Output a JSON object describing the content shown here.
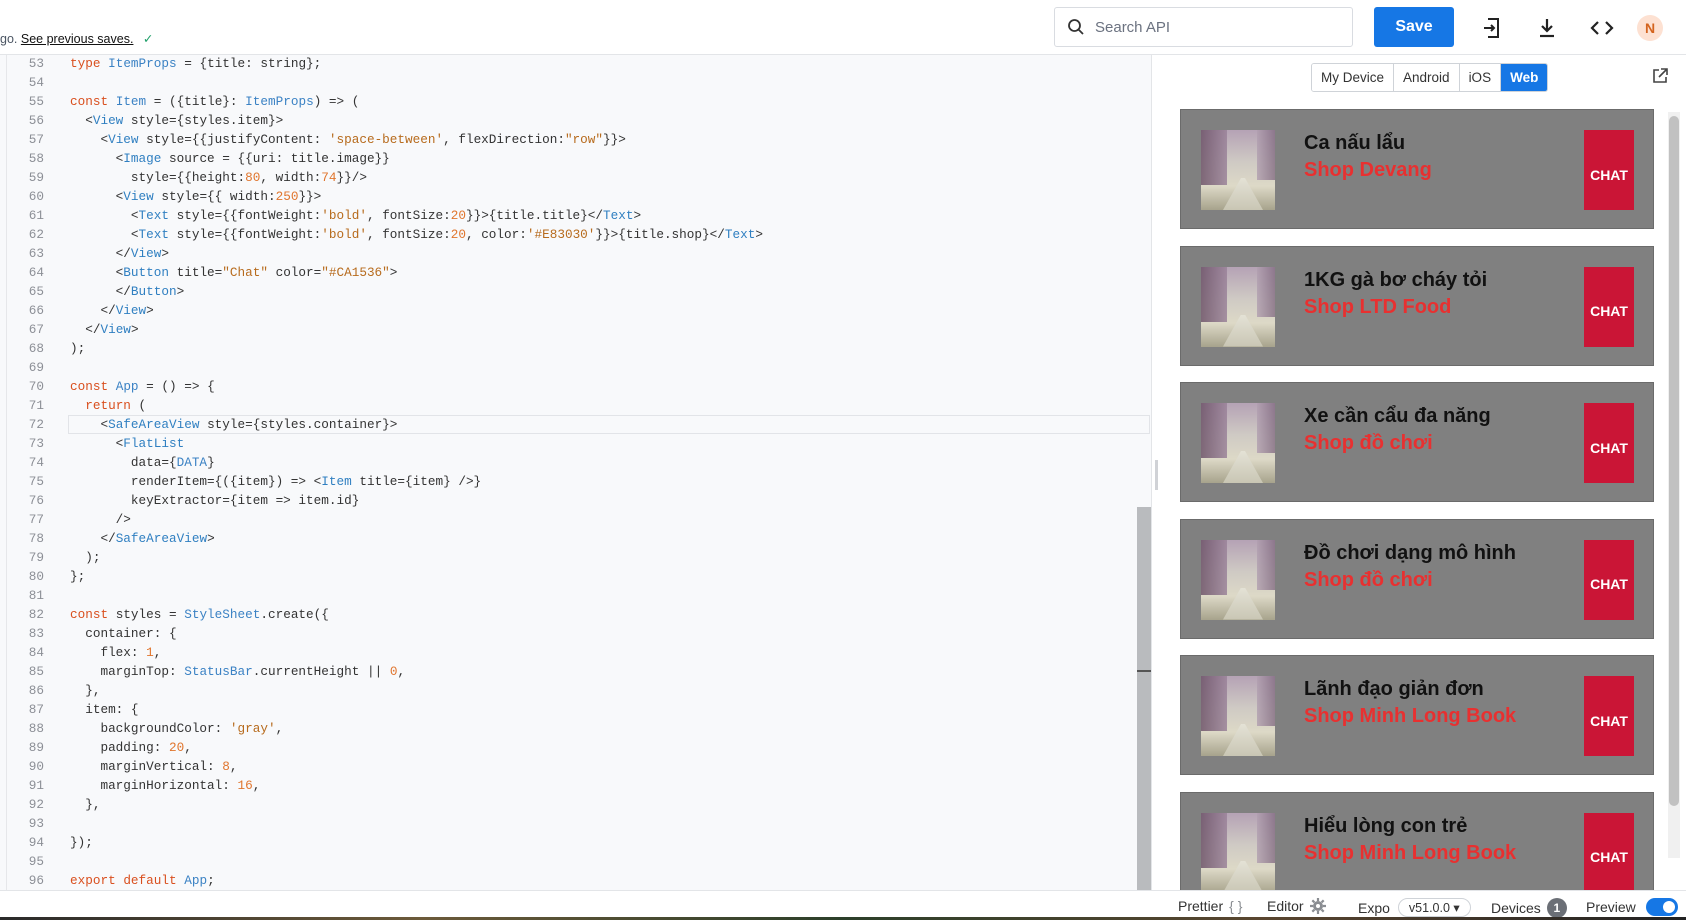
{
  "header": {
    "saves_prefix": "go.",
    "saves_link": "See previous saves.",
    "search_placeholder": "Search API",
    "save_label": "Save",
    "avatar_initial": "N"
  },
  "editor": {
    "lines": [
      {
        "n": "53",
        "html": "<span class='kw'>type</span> <span class='tp'>ItemProps</span> = {title: string};"
      },
      {
        "n": "54",
        "html": ""
      },
      {
        "n": "55",
        "html": "<span class='kw'>const</span> <span class='tp'>Item</span> = ({title}: <span class='tp'>ItemProps</span>) =&gt; ("
      },
      {
        "n": "56",
        "html": "  &lt;<span class='tg'>View</span> style={styles.item}&gt;"
      },
      {
        "n": "57",
        "html": "    &lt;<span class='tg'>View</span> style={{justifyContent: <span class='str'>'space-between'</span>, flexDirection:<span class='str'>\"row\"</span>}}&gt;"
      },
      {
        "n": "58",
        "html": "      &lt;<span class='tg'>Image</span> source = {{uri: title.image}}"
      },
      {
        "n": "59",
        "html": "        style={{height:<span class='num'>80</span>, width:<span class='num'>74</span>}}/&gt;"
      },
      {
        "n": "60",
        "html": "      &lt;<span class='tg'>View</span> style={{ width:<span class='num'>250</span>}}&gt;"
      },
      {
        "n": "61",
        "html": "        &lt;<span class='tg'>Text</span> style={{fontWeight:<span class='str'>'bold'</span>, fontSize:<span class='num'>20</span>}}&gt;{title.title}&lt;/<span class='tg'>Text</span>&gt;"
      },
      {
        "n": "62",
        "html": "        &lt;<span class='tg'>Text</span> style={{fontWeight:<span class='str'>'bold'</span>, fontSize:<span class='num'>20</span>, color:<span class='str'>'#E83030'</span>}}&gt;{title.shop}&lt;/<span class='tg'>Text</span>&gt;"
      },
      {
        "n": "63",
        "html": "      &lt;/<span class='tg'>View</span>&gt;"
      },
      {
        "n": "64",
        "html": "      &lt;<span class='tg'>Button</span> title=<span class='str'>\"Chat\"</span> color=<span class='str'>\"#CA1536\"</span>&gt;"
      },
      {
        "n": "65",
        "html": "      &lt;/<span class='tg'>Button</span>&gt;"
      },
      {
        "n": "66",
        "html": "    &lt;/<span class='tg'>View</span>&gt;"
      },
      {
        "n": "67",
        "html": "  &lt;/<span class='tg'>View</span>&gt;"
      },
      {
        "n": "68",
        "html": ");"
      },
      {
        "n": "69",
        "html": ""
      },
      {
        "n": "70",
        "html": "<span class='kw'>const</span> <span class='tp'>App</span> = () =&gt; {"
      },
      {
        "n": "71",
        "html": "  <span class='kw'>return</span> ("
      },
      {
        "n": "72",
        "html": "    &lt;<span class='tg'>SafeAreaView</span> style={styles.container}&gt;"
      },
      {
        "n": "73",
        "html": "      &lt;<span class='tg'>FlatList</span>"
      },
      {
        "n": "74",
        "html": "        data={<span class='tp'>DATA</span>}"
      },
      {
        "n": "75",
        "html": "        renderItem={({item}) =&gt; &lt;<span class='tg'>Item</span> title={item} /&gt;}"
      },
      {
        "n": "76",
        "html": "        keyExtractor={item =&gt; item.id}"
      },
      {
        "n": "77",
        "html": "      /&gt;"
      },
      {
        "n": "78",
        "html": "    &lt;/<span class='tg'>SafeAreaView</span>&gt;"
      },
      {
        "n": "79",
        "html": "  );"
      },
      {
        "n": "80",
        "html": "};"
      },
      {
        "n": "81",
        "html": ""
      },
      {
        "n": "82",
        "html": "<span class='kw'>const</span> styles = <span class='tp'>StyleSheet</span>.create({"
      },
      {
        "n": "83",
        "html": "  container: {"
      },
      {
        "n": "84",
        "html": "    flex: <span class='num'>1</span>,"
      },
      {
        "n": "85",
        "html": "    marginTop: <span class='tp'>StatusBar</span>.currentHeight || <span class='num'>0</span>,"
      },
      {
        "n": "86",
        "html": "  },"
      },
      {
        "n": "87",
        "html": "  item: {"
      },
      {
        "n": "88",
        "html": "    backgroundColor: <span class='str'>'gray'</span>,"
      },
      {
        "n": "89",
        "html": "    padding: <span class='num'>20</span>,"
      },
      {
        "n": "90",
        "html": "    marginVertical: <span class='num'>8</span>,"
      },
      {
        "n": "91",
        "html": "    marginHorizontal: <span class='num'>16</span>,"
      },
      {
        "n": "92",
        "html": "  },"
      },
      {
        "n": "93",
        "html": ""
      },
      {
        "n": "94",
        "html": "});"
      },
      {
        "n": "95",
        "html": ""
      },
      {
        "n": "96",
        "html": "<span class='kw'>export</span> <span class='kw'>default</span> <span class='tp'>App</span>;"
      }
    ]
  },
  "preview": {
    "device_tabs": [
      "My Device",
      "Android",
      "iOS",
      "Web"
    ],
    "active_tab": "Web",
    "items": [
      {
        "title": "Ca nấu lẩu",
        "shop": "Shop Devang",
        "button": "CHAT"
      },
      {
        "title": "1KG gà bơ cháy tỏi",
        "shop": "Shop LTD Food",
        "button": "CHAT"
      },
      {
        "title": "Xe cần cẩu đa năng",
        "shop": "Shop đồ chơi",
        "button": "CHAT"
      },
      {
        "title": "Đồ chơi dạng mô hình",
        "shop": "Shop đồ chơi",
        "button": "CHAT"
      },
      {
        "title": "Lãnh đạo giản đơn",
        "shop": "Shop Minh Long Book",
        "button": "CHAT"
      },
      {
        "title": "Hiểu lòng con trẻ",
        "shop": "Shop Minh Long Book",
        "button": "CHAT"
      }
    ]
  },
  "footer": {
    "prettier": "Prettier",
    "prettier_icon": "{ }",
    "editor": "Editor",
    "expo": "Expo",
    "sdk_version": "v51.0.0 ▾",
    "devices": "Devices",
    "devices_count": "1",
    "preview": "Preview"
  }
}
